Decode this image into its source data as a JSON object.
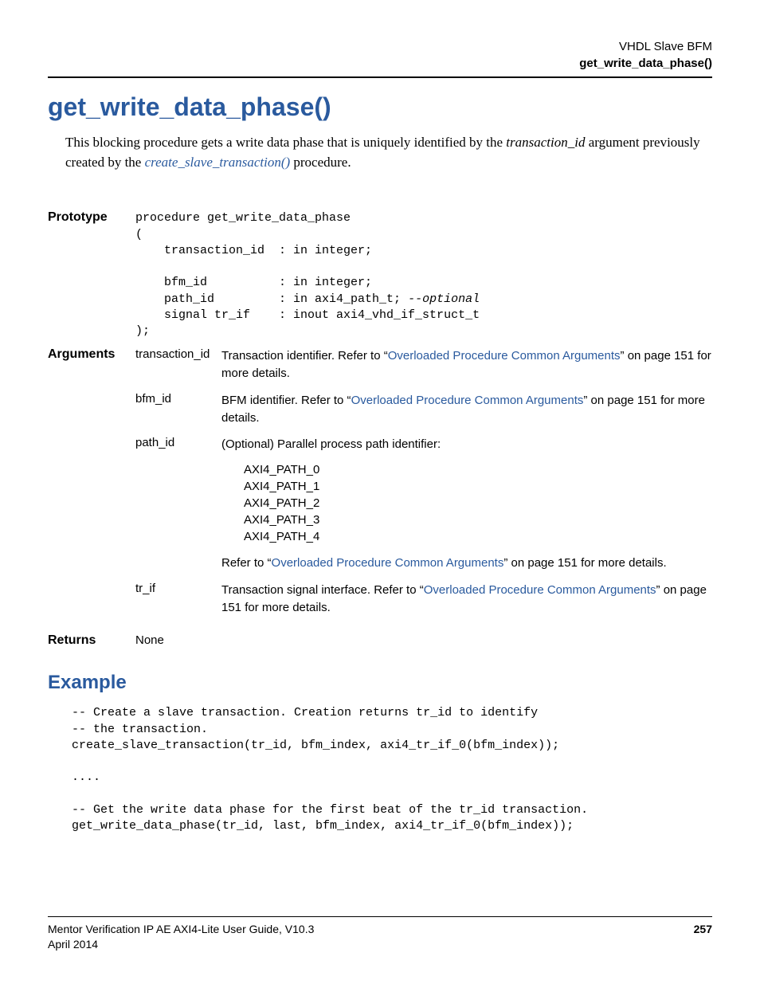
{
  "header": {
    "line1": "VHDL Slave BFM",
    "line2": "get_write_data_phase()"
  },
  "title": "get_write_data_phase()",
  "intro": {
    "pre": "This blocking procedure gets a write data phase that is uniquely identified by the ",
    "param": "transaction_id",
    "mid": " argument previously created by the ",
    "link": "create_slave_transaction()",
    "post": " procedure."
  },
  "labels": {
    "prototype": "Prototype",
    "arguments": "Arguments",
    "returns": "Returns"
  },
  "prototype": {
    "l1": "procedure get_write_data_phase",
    "l2": "(",
    "l3": "    transaction_id  : in integer;",
    "lblank": "",
    "l4": "    bfm_id          : in integer;",
    "l5a": "    path_id         : in axi4_path_t; ",
    "l5opt": "--optional",
    "l6": "    signal tr_if    : inout axi4_vhd_if_struct_t",
    "l7": ");"
  },
  "args": {
    "transaction_id": {
      "name": "transaction_id",
      "pre": "Transaction identifier. Refer to “",
      "link": "Overloaded Procedure Common Arguments",
      "post": "” on page 151 for more details."
    },
    "bfm_id": {
      "name": "bfm_id",
      "pre": "BFM identifier. Refer to “",
      "link": "Overloaded Procedure Common Arguments",
      "post": "” on page 151 for more details."
    },
    "path_id": {
      "name": "path_id",
      "intro": "(Optional) Parallel process path identifier:",
      "p0": "AXI4_PATH_0",
      "p1": "AXI4_PATH_1",
      "p2": "AXI4_PATH_2",
      "p3": "AXI4_PATH_3",
      "p4": "AXI4_PATH_4",
      "refpre": "Refer to “",
      "reflink": "Overloaded Procedure Common Arguments",
      "refpost": "” on page 151 for more details."
    },
    "tr_if": {
      "name": "tr_if",
      "pre": "Transaction signal interface. Refer to “",
      "link": "Overloaded Procedure Common Arguments",
      "post": "” on page 151 for more details."
    }
  },
  "returns": "None",
  "example": {
    "heading": "Example",
    "c1": "-- Create a slave transaction. Creation returns tr_id to identify",
    "c2": "-- the transaction.",
    "c3": "create_slave_transaction(tr_id, bfm_index, axi4_tr_if_0(bfm_index));",
    "c4": "",
    "c5": "....",
    "c6": "",
    "c7": "-- Get the write data phase for the first beat of the tr_id transaction.",
    "c8": "get_write_data_phase(tr_id, last, bfm_index, axi4_tr_if_0(bfm_index));"
  },
  "footer": {
    "doc": "Mentor Verification IP AE AXI4-Lite User Guide, V10.3",
    "date": "April 2014",
    "page": "257"
  }
}
